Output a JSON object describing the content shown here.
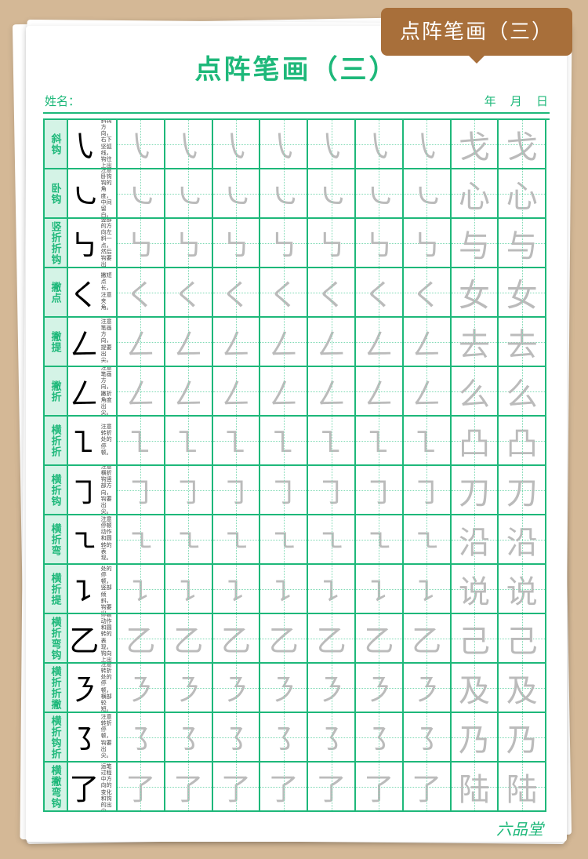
{
  "tab_title": "点阵笔画（三）",
  "page_title": "点阵笔画（三）",
  "name_label": "姓名：",
  "date": {
    "year": "年",
    "month": "月",
    "day": "日"
  },
  "brand": "六品堂",
  "strokes": [
    {
      "label": "斜钩",
      "glyph": "㇂",
      "note": "注意斜钩方向，右下坚弧线，钩往上出尖。",
      "char": "戈"
    },
    {
      "label": "卧钩",
      "glyph": "㇃",
      "note": "注意卧钩钩的角度，中间留白。",
      "char": "心"
    },
    {
      "label": "竖折折钩",
      "glyph": "㇉",
      "note": "注意竖部的方向左斜一点，然后钩要出尖。",
      "char": "与"
    },
    {
      "label": "撇点",
      "glyph": "く",
      "note": "撇短点长，注意夹角。",
      "char": "女"
    },
    {
      "label": "撇提",
      "glyph": "ㄥ",
      "note": "注意笔画方向，提要出尖。",
      "char": "去"
    },
    {
      "label": "撇折",
      "glyph": "ㄥ",
      "note": "注意笔画方向，撇折角度出尖。",
      "char": "么"
    },
    {
      "label": "横折折",
      "glyph": "㇅",
      "note": "注意转折处的停顿。",
      "char": "凸"
    },
    {
      "label": "横折钩",
      "glyph": "㇆",
      "note": "注意横折钩竖部方向，钩要出尖。",
      "char": "刀"
    },
    {
      "label": "横折弯",
      "glyph": "㇍",
      "note": "注意停顿动作和圆转的表现。",
      "char": "沿"
    },
    {
      "label": "横折提",
      "glyph": "㇊",
      "note": "注意转折处的停顿，竖部倾斜，钩要出尖。",
      "char": "说"
    },
    {
      "label": "横折弯钩",
      "glyph": "乙",
      "note": "注意停顿动作和圆转的表现，钩向上出尖。",
      "char": "己"
    },
    {
      "label": "横折折撇",
      "glyph": "㇋",
      "note": "注意转折处的停顿，横部较短。",
      "char": "及"
    },
    {
      "label": "横折钩折",
      "glyph": "㇌",
      "note": "注意转折停顿，钩要出尖。",
      "char": "乃"
    },
    {
      "label": "横撇弯钩",
      "glyph": "了",
      "note": "注意运笔过程中方向的变化和钩的出尖。",
      "char": "陆"
    }
  ]
}
